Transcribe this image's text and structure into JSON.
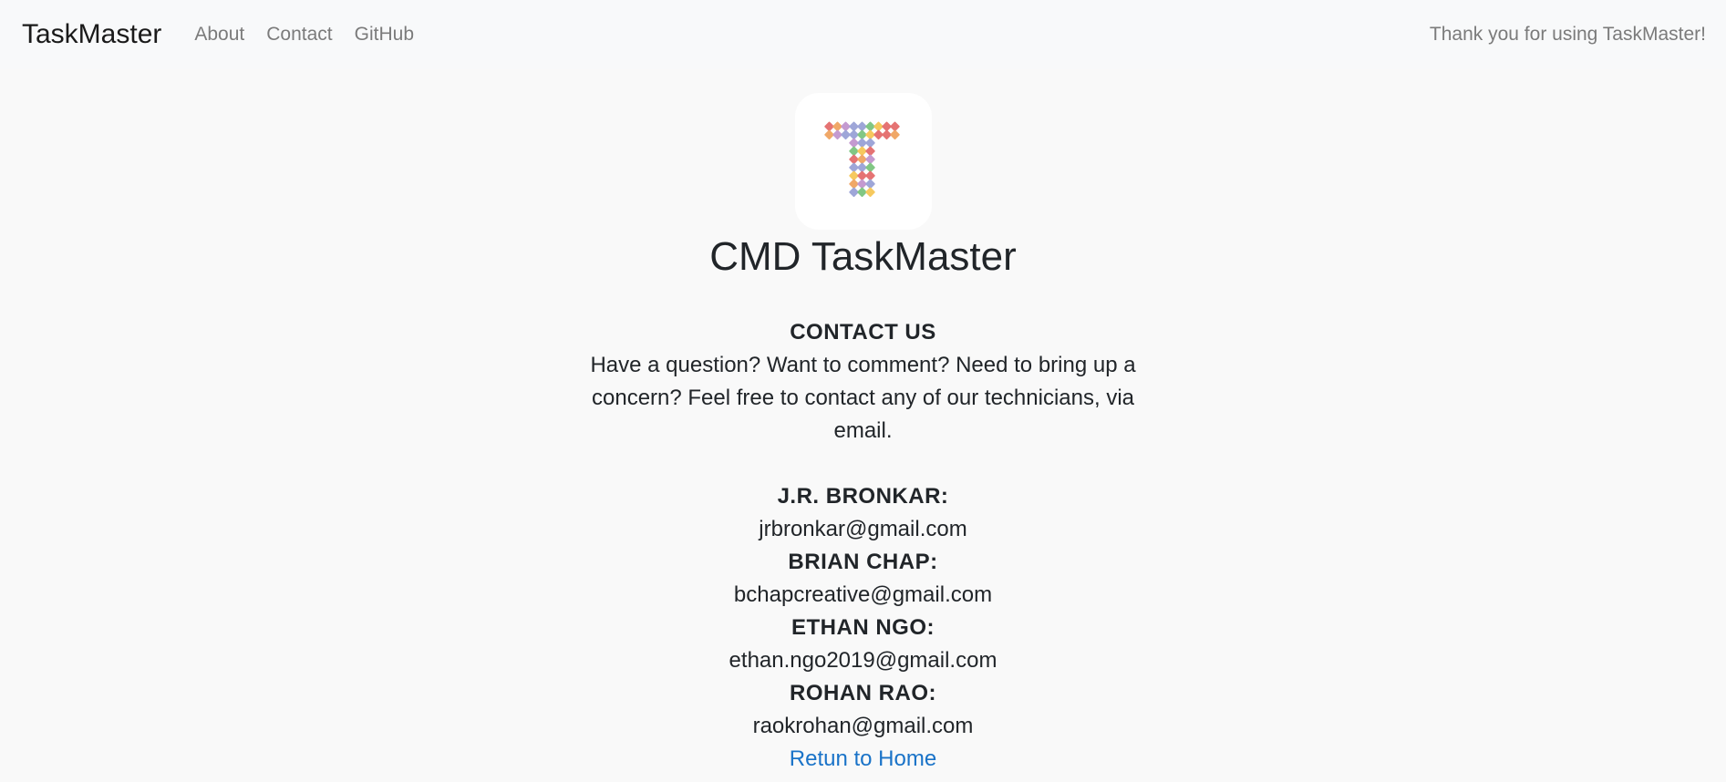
{
  "navbar": {
    "brand": "TaskMaster",
    "links": [
      "About",
      "Contact",
      "GitHub"
    ],
    "right_text": "Thank you for using TaskMaster!"
  },
  "main": {
    "title": "CMD TaskMaster",
    "contact_heading": "CONTACT US",
    "intro": "Have a question? Want to comment? Need to bring up a concern? Feel free to contact any of our technicians, via email.",
    "contacts": [
      {
        "name": "J.R. BRONKAR:",
        "email": "jrbronkar@gmail.com"
      },
      {
        "name": "BRIAN CHAP:",
        "email": "bchapcreative@gmail.com"
      },
      {
        "name": "ETHAN NGO:",
        "email": "ethan.ngo2019@gmail.com"
      },
      {
        "name": "ROHAN RAO:",
        "email": "raokrohan@gmail.com"
      }
    ],
    "return_link": "Retun to Home"
  },
  "logo_colors": [
    "#e57373",
    "#f6c95e",
    "#81c784",
    "#9ea6d8",
    "#c49ad0",
    "#f0a868"
  ]
}
